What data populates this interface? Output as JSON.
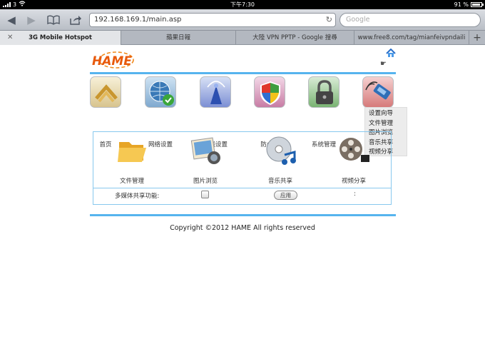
{
  "status_bar": {
    "carrier": "3",
    "time": "下午7:30",
    "battery_percent": "91 %",
    "battery_level": 0.91
  },
  "toolbar": {
    "url": "192.168.169.1/main.asp",
    "search_placeholder": "Google"
  },
  "tabs": [
    {
      "label": "3G Mobile Hotspot",
      "active": true
    },
    {
      "label": "蘋果日報",
      "active": false
    },
    {
      "label": "大陸 VPN PPTP - Google 搜尋",
      "active": false
    },
    {
      "label": "www.free8.com/tag/mianfeivpndaili",
      "active": false
    }
  ],
  "page": {
    "logo_text": "HAME",
    "nav": [
      {
        "label": "首页",
        "icon": "home-nav-icon"
      },
      {
        "label": "网络设置",
        "icon": "globe-check-icon"
      },
      {
        "label": "无线设置",
        "icon": "wireless-icon"
      },
      {
        "label": "防火墙",
        "icon": "shield-icon"
      },
      {
        "label": "系统管理",
        "icon": "lock-icon"
      },
      {
        "label": "",
        "icon": "satellite-icon"
      }
    ],
    "submenu": [
      "设置向导",
      "文件管理",
      "图片浏览",
      "音乐共享",
      "视频分享"
    ],
    "features": [
      {
        "label": "文件管理",
        "icon": "folder-icon"
      },
      {
        "label": "图片浏览",
        "icon": "photo-icon"
      },
      {
        "label": "音乐共享",
        "icon": "music-disc-icon"
      },
      {
        "label": "视频分享",
        "icon": "film-reel-icon"
      }
    ],
    "share_label": "多媒体共享功能:",
    "apply_label": "应用",
    "colon": ":",
    "copyright": "Copyright ©2012 HAME All rights reserved"
  }
}
